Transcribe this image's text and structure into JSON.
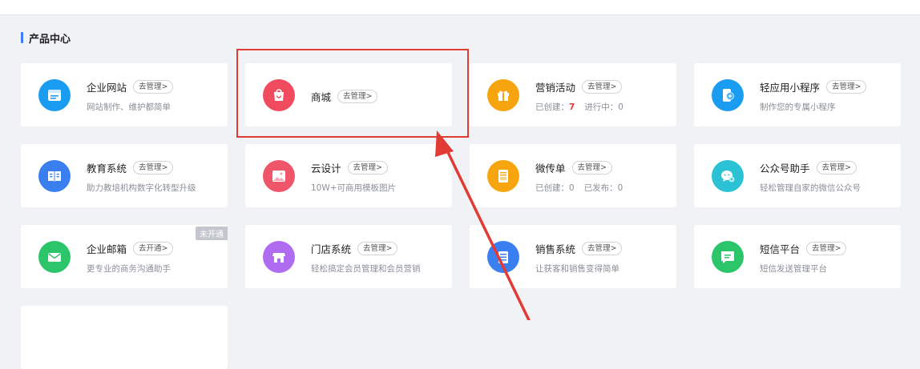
{
  "section": {
    "title": "产品中心"
  },
  "cards": [
    {
      "name": "企业网站",
      "manage": "去管理>",
      "desc": "网站制作、维护都简单",
      "icon": "website-icon",
      "color": "#1a9cf0"
    },
    {
      "name": "商城",
      "manage": "去管理>",
      "icon": "shopping-bag-icon",
      "color": "#f04b5e"
    },
    {
      "name": "营销活动",
      "manage": "去管理>",
      "desc_prefix": "已创建：",
      "desc_count": "7",
      "desc_suffix": "进行中：0",
      "icon": "gift-icon",
      "color": "#f6a50f"
    },
    {
      "name": "轻应用小程序",
      "manage": "去管理>",
      "desc": "制作您的专属小程序",
      "icon": "mini-program-icon",
      "color": "#1a9cf0"
    },
    {
      "name": "教育系统",
      "manage": "去管理>",
      "desc": "助力教培机构数字化转型升级",
      "icon": "book-icon",
      "color": "#3a7ff0"
    },
    {
      "name": "云设计",
      "manage": "去管理>",
      "desc": "10W+可商用模板图片",
      "icon": "image-icon",
      "color": "#f0566a"
    },
    {
      "name": "微传单",
      "manage": "去管理>",
      "desc_a": "已创建：0",
      "desc_b": "已发布：0",
      "icon": "flyer-icon",
      "color": "#f6a50f"
    },
    {
      "name": "公众号助手",
      "manage": "去管理>",
      "desc": "轻松管理自家的微信公众号",
      "icon": "wechat-icon",
      "color": "#2cc2d6"
    },
    {
      "name": "企业邮箱",
      "manage": "去开通>",
      "desc": "更专业的商务沟通助手",
      "badge": "未开通",
      "icon": "mail-icon",
      "color": "#2cc56a"
    },
    {
      "name": "门店系统",
      "manage": "去管理>",
      "desc": "轻松搞定会员管理和会员营销",
      "icon": "store-icon",
      "color": "#b06cf0"
    },
    {
      "name": "销售系统",
      "manage": "去管理>",
      "desc": "让获客和销售变得简单",
      "icon": "list-icon",
      "color": "#3a7ff0"
    },
    {
      "name": "短信平台",
      "manage": "去管理>",
      "desc": "短信发送管理平台",
      "icon": "message-icon",
      "color": "#2cc56a"
    }
  ],
  "annotation": {
    "color": "#e23a35"
  }
}
